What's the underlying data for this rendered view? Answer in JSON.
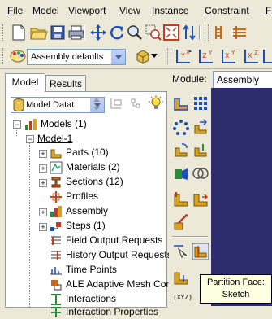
{
  "menu": {
    "items": [
      {
        "label": "File",
        "u": "F",
        "rest": "ile"
      },
      {
        "label": "Model",
        "u": "M",
        "rest": "odel"
      },
      {
        "label": "Viewport",
        "u": "Vie",
        "rest": "wport"
      },
      {
        "label": "View",
        "u": "V",
        "rest": "iew"
      },
      {
        "label": "Instance",
        "u": "I",
        "rest": "nstance"
      },
      {
        "label": "Constraint",
        "u": "C",
        "rest": "onstraint"
      },
      {
        "label": "F",
        "u": "F",
        "rest": ""
      }
    ]
  },
  "toolbar2": {
    "assembly_defaults": "Assembly defaults"
  },
  "tabs": [
    {
      "label": "Model"
    },
    {
      "label": "Results"
    }
  ],
  "tree": {
    "database_label": "Model Datat",
    "root": "Models (1)",
    "model": "Model-1",
    "items": [
      {
        "label": "Parts (10)",
        "icon": "parts-icon",
        "expander": "+"
      },
      {
        "label": "Materials (2)",
        "icon": "materials-icon",
        "expander": "+"
      },
      {
        "label": "Sections (12)",
        "icon": "sections-icon",
        "expander": "+"
      },
      {
        "label": "Profiles",
        "icon": "profiles-icon",
        "expander": ""
      },
      {
        "label": "Assembly",
        "icon": "assembly-icon",
        "expander": "+"
      },
      {
        "label": "Steps (1)",
        "icon": "steps-icon",
        "expander": "+"
      },
      {
        "label": "Field Output Requests",
        "icon": "field-output-icon",
        "expander": ""
      },
      {
        "label": "History Output Requests",
        "icon": "history-output-icon",
        "expander": ""
      },
      {
        "label": "Time Points",
        "icon": "time-points-icon",
        "expander": ""
      },
      {
        "label": "ALE Adaptive Mesh Const",
        "icon": "ale-mesh-icon",
        "expander": ""
      },
      {
        "label": "Interactions",
        "icon": "interactions-icon",
        "expander": ""
      },
      {
        "label": "Interaction Properties",
        "icon": "interaction-properties-icon",
        "expander": ""
      }
    ]
  },
  "module": {
    "label": "Module:",
    "value": "Assembly"
  },
  "tooltip": {
    "line1": "Partition Face:",
    "line2": "Sketch"
  },
  "colors": {
    "viewport_bg": "#2E2E6E",
    "window_bg": "#ECE9D8",
    "tooltip_bg": "#FFFFE1"
  }
}
